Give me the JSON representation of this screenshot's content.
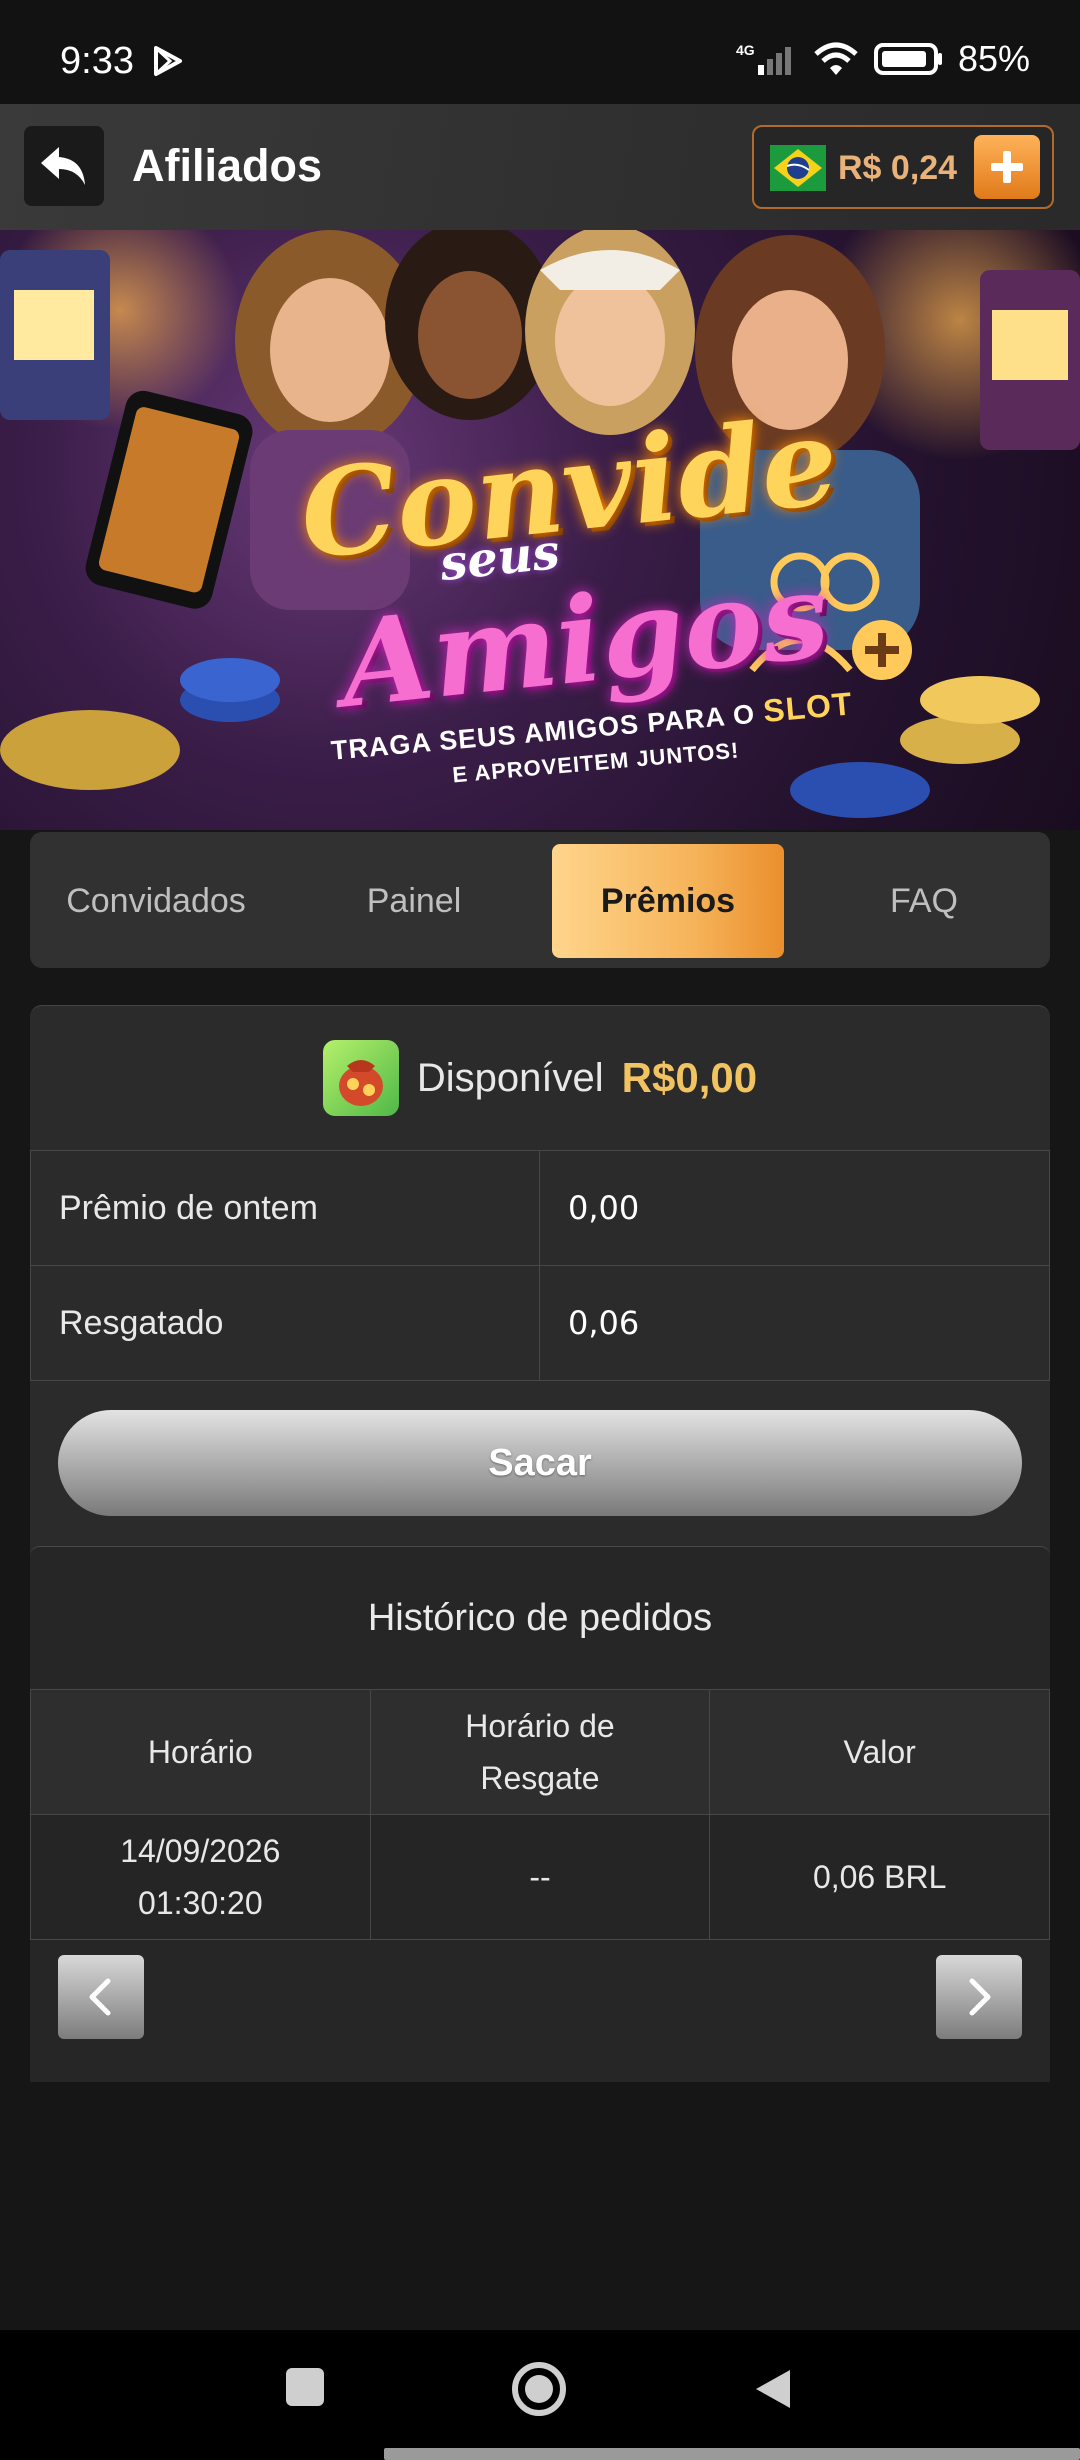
{
  "status_bar": {
    "time": "9:33",
    "network": "4G",
    "battery": "85%"
  },
  "header": {
    "title": "Afiliados",
    "balance": "R$ 0,24"
  },
  "banner": {
    "line1": "Convide",
    "line2": "seus",
    "line3": "Amigos",
    "sub1_prefix": "TRAGA SEUS AMIGOS PARA O",
    "sub1_highlight": "SLOT",
    "sub2": "E APROVEITEM JUNTOS!"
  },
  "tabs": [
    {
      "label": "Convidados",
      "active": false
    },
    {
      "label": "Painel",
      "active": false
    },
    {
      "label": "Prêmios",
      "active": true
    },
    {
      "label": "FAQ",
      "active": false
    }
  ],
  "available": {
    "label": "Disponível",
    "amount": "R$0,00"
  },
  "stats": [
    {
      "label": "Prêmio de ontem",
      "value": "0,00"
    },
    {
      "label": "Resgatado",
      "value": "0,06"
    }
  ],
  "withdraw_label": "Sacar",
  "history": {
    "title": "Histórico de pedidos",
    "columns": [
      "Horário",
      "Horário de Resgate",
      "Valor"
    ],
    "rows": [
      {
        "time": "14/09/2026 01:30:20",
        "redeem_time": "--",
        "value": "0,06 BRL"
      }
    ]
  },
  "colors": {
    "accent": "#f6b45a",
    "gold_text": "#f2c361",
    "background": "#161616"
  }
}
